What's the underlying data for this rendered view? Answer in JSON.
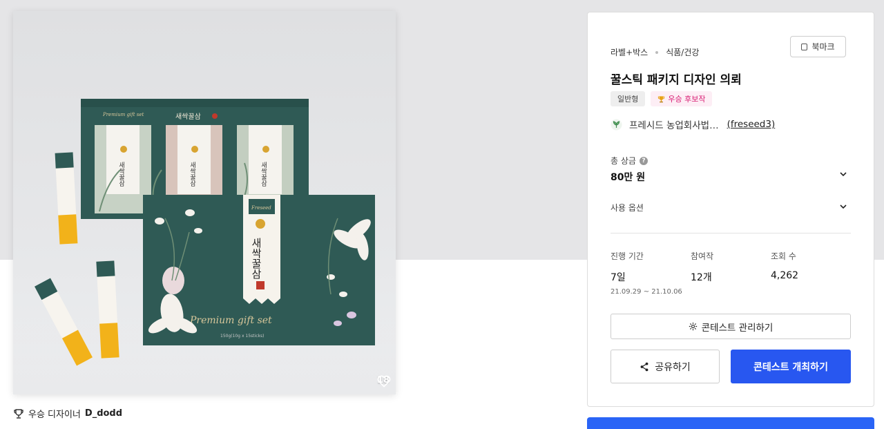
{
  "image": {
    "likes": "18",
    "like_icon": "heart-icon",
    "box_brand": "새싹꿀삼",
    "box_subtitle": "Premium gift set",
    "box_spec": "150g(10g x 15sticks)",
    "stick_brand": "Freseed"
  },
  "winner": {
    "label": "우승 디자이너",
    "name": "D_dodd",
    "icon": "trophy-icon"
  },
  "panel": {
    "category_main": "라벨+박스",
    "category_sub": "식품/건강",
    "bookmark_label": "북마크",
    "title": "꿀스틱 패키지 디자인 의뢰",
    "badges": [
      "일반형",
      "우승 후보작"
    ],
    "company_name": "프레시드 농업회사법…",
    "company_handle": "(freseed3)",
    "prize_label": "총 상금",
    "prize_value": "80만 원",
    "options_label": "사용 옵션",
    "stats": {
      "period_label": "진행 기간",
      "period_value": "7일",
      "period_dates": "21.09.29 ~ 21.10.06",
      "entries_label": "참여작",
      "entries_value": "12개",
      "views_label": "조회 수",
      "views_value": "4,262"
    },
    "manage_label": "콘테스트 관리하기",
    "share_label": "공유하기",
    "host_label": "콘테스트 개최하기"
  },
  "colors": {
    "primary": "#2857f0",
    "box_green": "#2f5a55",
    "badge_pink": "#d81b72"
  }
}
